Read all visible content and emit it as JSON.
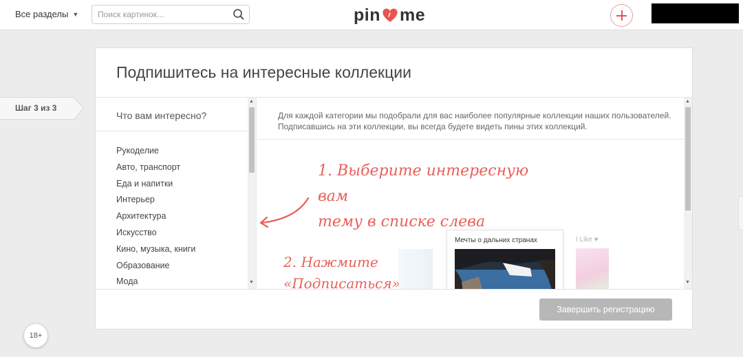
{
  "header": {
    "sections_label": "Все разделы",
    "search_placeholder": "Поиск картинок...",
    "logo_left": "pin",
    "logo_right": "me"
  },
  "step": {
    "label": "Шаг 3 из 3"
  },
  "card": {
    "title": "Подпишитесь на интересные коллекции",
    "left_question": "Что вам интересно?",
    "categories": [
      "Рукоделие",
      "Авто, транспорт",
      "Еда и напитки",
      "Интерьер",
      "Архитектура",
      "Искусство",
      "Кино, музыка, книги",
      "Образование",
      "Мода"
    ],
    "intro": "Для каждой категории мы подобрали для вас наиболее популярные коллекции наших пользователей. Подписавшись на эти коллекции, вы всегда будете видеть пины этих коллекций.",
    "hint1_line1": "1. Выберите интересную вам",
    "hint1_line2": "тему в списке слева",
    "hint2_line1": "2. Нажмите",
    "hint2_line2": "«Подписаться»",
    "collection_a_title": "Мечты о дальних странах",
    "collection_b_title": "I Like ♥",
    "finish_label": "Завершить регистрацию"
  },
  "age_badge": "18+",
  "colors": {
    "accent": "#e8605a",
    "button_disabled": "#b7b7b7",
    "background": "#ececec"
  },
  "icons": [
    "chevron-down-icon",
    "search-icon",
    "heart-icon",
    "plus-icon",
    "arrow-icon"
  ]
}
